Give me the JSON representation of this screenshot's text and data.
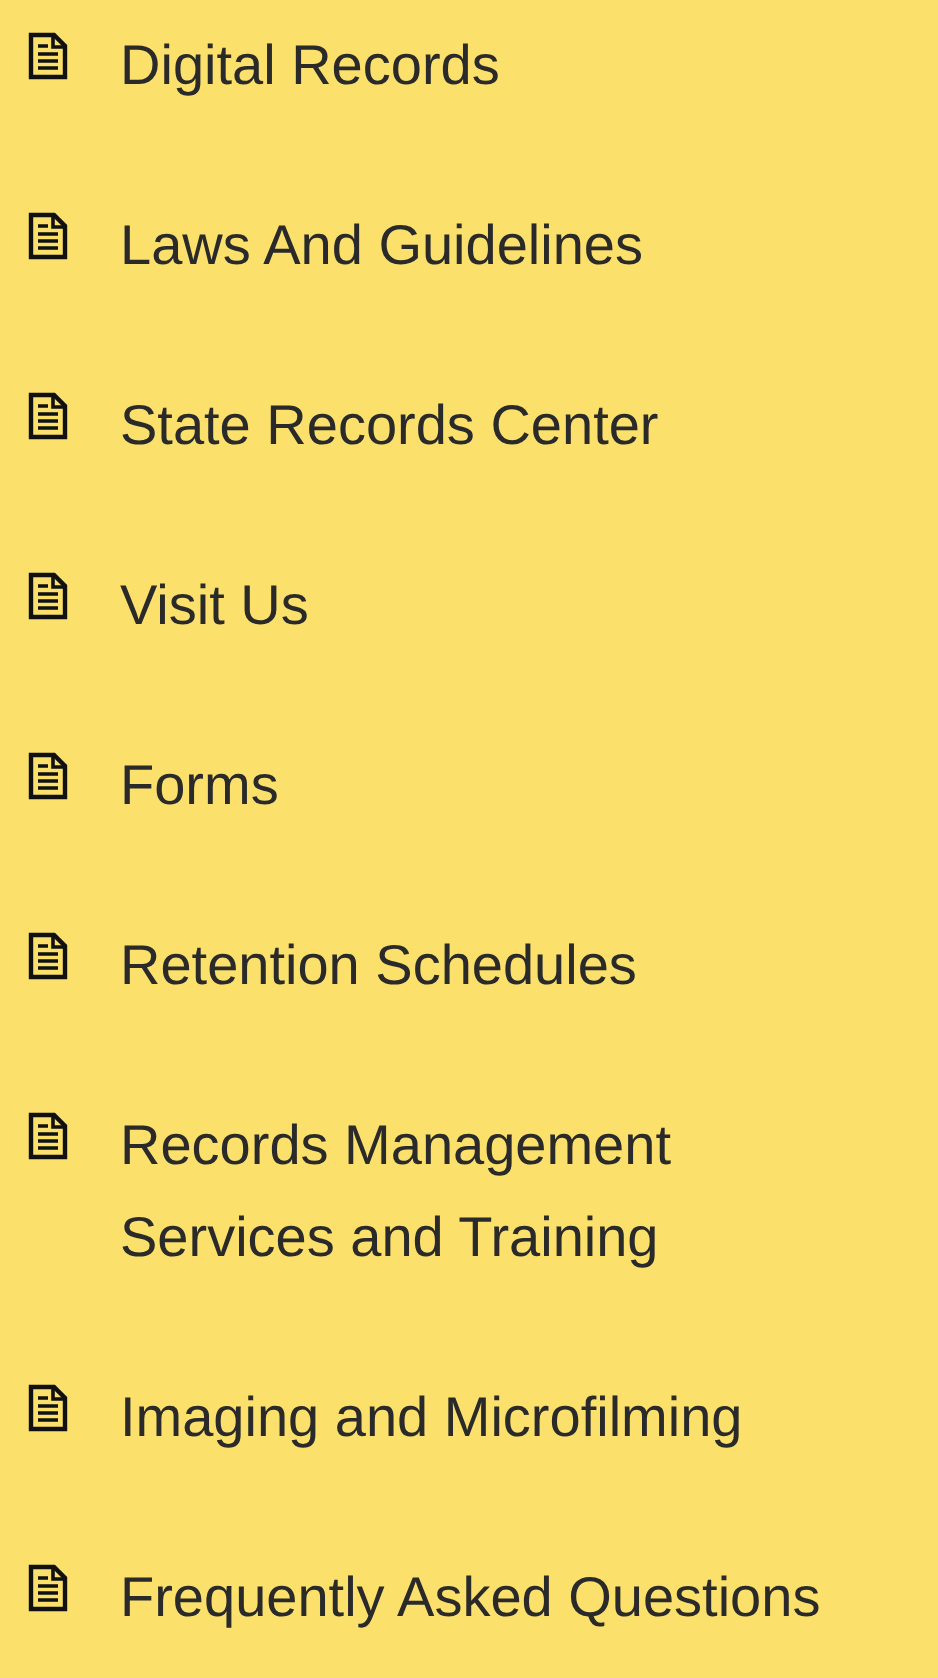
{
  "menu": {
    "items": [
      {
        "label": "Digital Records"
      },
      {
        "label": "Laws And Guidelines"
      },
      {
        "label": "State Records Center"
      },
      {
        "label": "Visit Us"
      },
      {
        "label": "Forms"
      },
      {
        "label": "Retention Schedules"
      },
      {
        "label": "Records Management Services and Training"
      },
      {
        "label": "Imaging and Microfilming"
      },
      {
        "label": "Frequently Asked Questions"
      }
    ]
  }
}
